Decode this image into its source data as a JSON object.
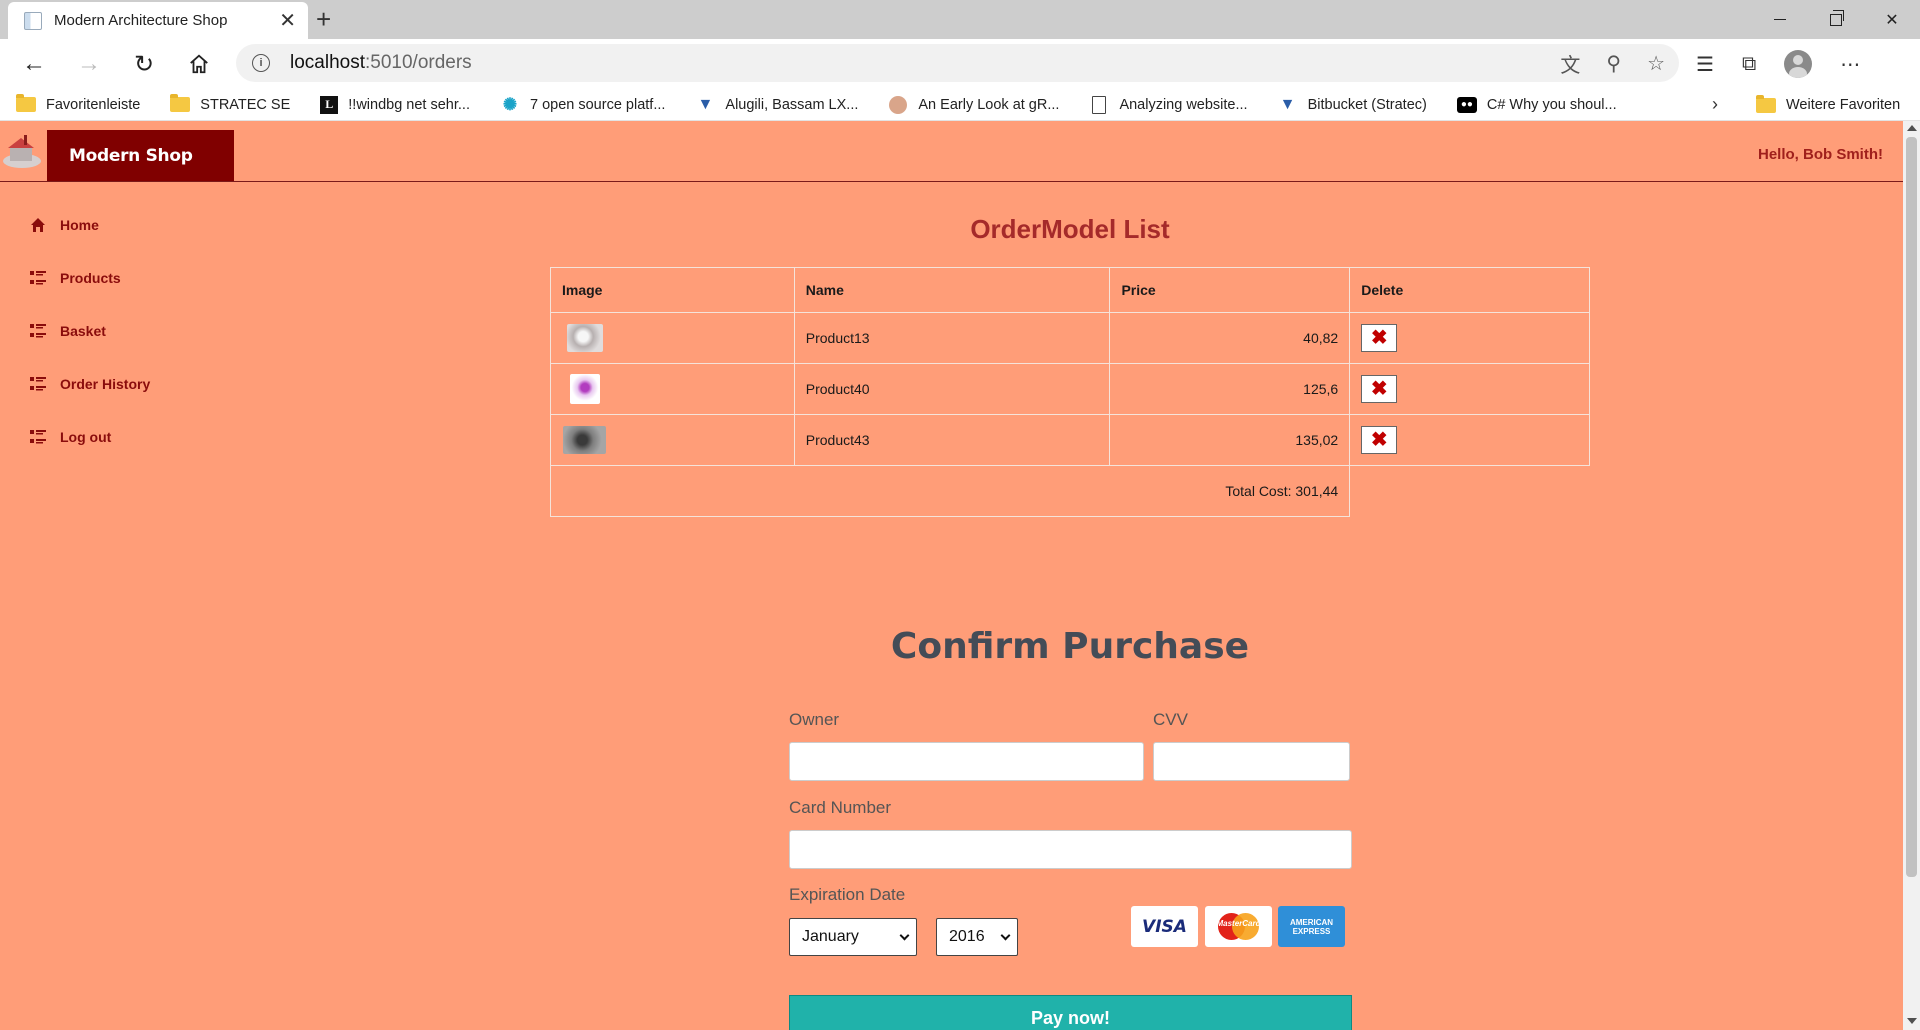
{
  "browser": {
    "tab_title": "Modern Architecture Shop",
    "url_host": "localhost",
    "url_path": ":5010/orders",
    "bookmarks": [
      {
        "label": "Favoritenleiste",
        "icon": "folder-icon"
      },
      {
        "label": "STRATEC SE",
        "icon": "folder-icon"
      },
      {
        "label": "!!windbg  net sehr...",
        "icon": "letter-l-icon"
      },
      {
        "label": "7 open source platf...",
        "icon": "gear-icon"
      },
      {
        "label": "Alugili, Bassam   LX...",
        "icon": "bitbucket-icon"
      },
      {
        "label": "An Early Look at gR...",
        "icon": "avatar-icon"
      },
      {
        "label": "Analyzing website...",
        "icon": "document-icon"
      },
      {
        "label": "Bitbucket (Stratec)",
        "icon": "bitbucket-icon"
      },
      {
        "label": "C#  Why you shoul...",
        "icon": "medium-icon"
      }
    ],
    "more_bookmarks": "Weitere Favoriten"
  },
  "header": {
    "brand": "Modern Shop",
    "greeting": "Hello, Bob Smith!"
  },
  "sidebar": {
    "items": [
      {
        "label": "Home",
        "icon": "home-icon"
      },
      {
        "label": "Products",
        "icon": "list-icon"
      },
      {
        "label": "Basket",
        "icon": "list-icon"
      },
      {
        "label": "Order History",
        "icon": "list-icon"
      },
      {
        "label": "Log out",
        "icon": "list-icon"
      }
    ]
  },
  "orders": {
    "title": "OrderModel List",
    "columns": [
      "Image",
      "Name",
      "Price",
      "Delete"
    ],
    "rows": [
      {
        "name": "Product13",
        "price": "40,82"
      },
      {
        "name": "Product40",
        "price": "125,6"
      },
      {
        "name": "Product43",
        "price": "135,02"
      }
    ],
    "total": "Total Cost: 301,44"
  },
  "purchase": {
    "title": "Confirm Purchase",
    "owner_label": "Owner",
    "owner_value": "",
    "cvv_label": "CVV",
    "cvv_value": "",
    "card_number_label": "Card Number",
    "card_number_value": "",
    "expiration_label": "Expiration Date",
    "month_selected": "January",
    "year_selected": "2016",
    "cards": [
      "VISA",
      "MasterCard",
      "AMERICAN EXPRESS"
    ],
    "pay_label": "Pay now!"
  },
  "colors": {
    "page_bg": "#ff9d78",
    "brand_bg": "#800000",
    "pay_button": "#20b2aa"
  }
}
